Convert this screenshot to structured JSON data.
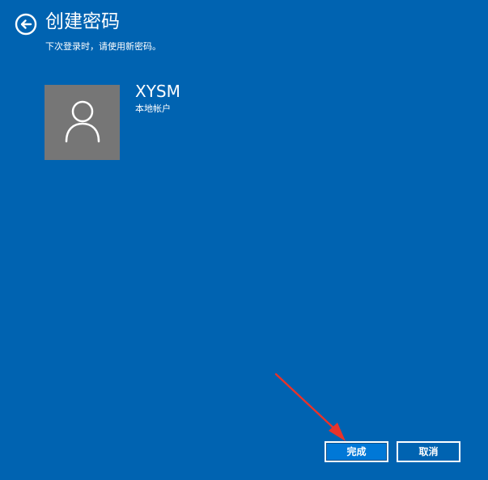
{
  "header": {
    "title": "创建密码",
    "subtitle": "下次登录时，请使用新密码。"
  },
  "account": {
    "name": "XYSM",
    "type": "本地帐户"
  },
  "buttons": {
    "finish_label": "完成",
    "cancel_label": "取消"
  },
  "colors": {
    "background": "#0063b1",
    "avatar": "#767676",
    "annotation_arrow": "#e8332a"
  },
  "icons": {
    "back": "back-arrow-circle-icon",
    "avatar": "user-icon"
  }
}
